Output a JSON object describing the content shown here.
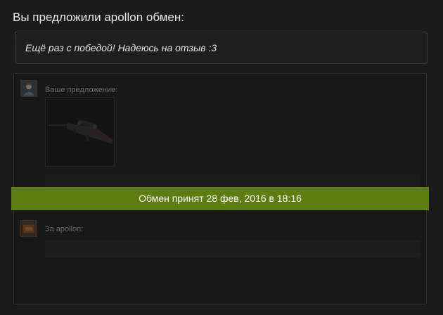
{
  "header": {
    "title": "Вы предложили apollon обмен:"
  },
  "message": {
    "text": "Ещё раз с победой! Надеюсь на отзыв :3"
  },
  "trade": {
    "your_offer_label": "Ваше предложение:",
    "for_partner_label": "За apollon:",
    "items": [
      {
        "icon": "rifle-icon"
      }
    ]
  },
  "status": {
    "text": "Обмен принят 28 фев, 2016 в 18:16",
    "color": "#5c7e10"
  }
}
